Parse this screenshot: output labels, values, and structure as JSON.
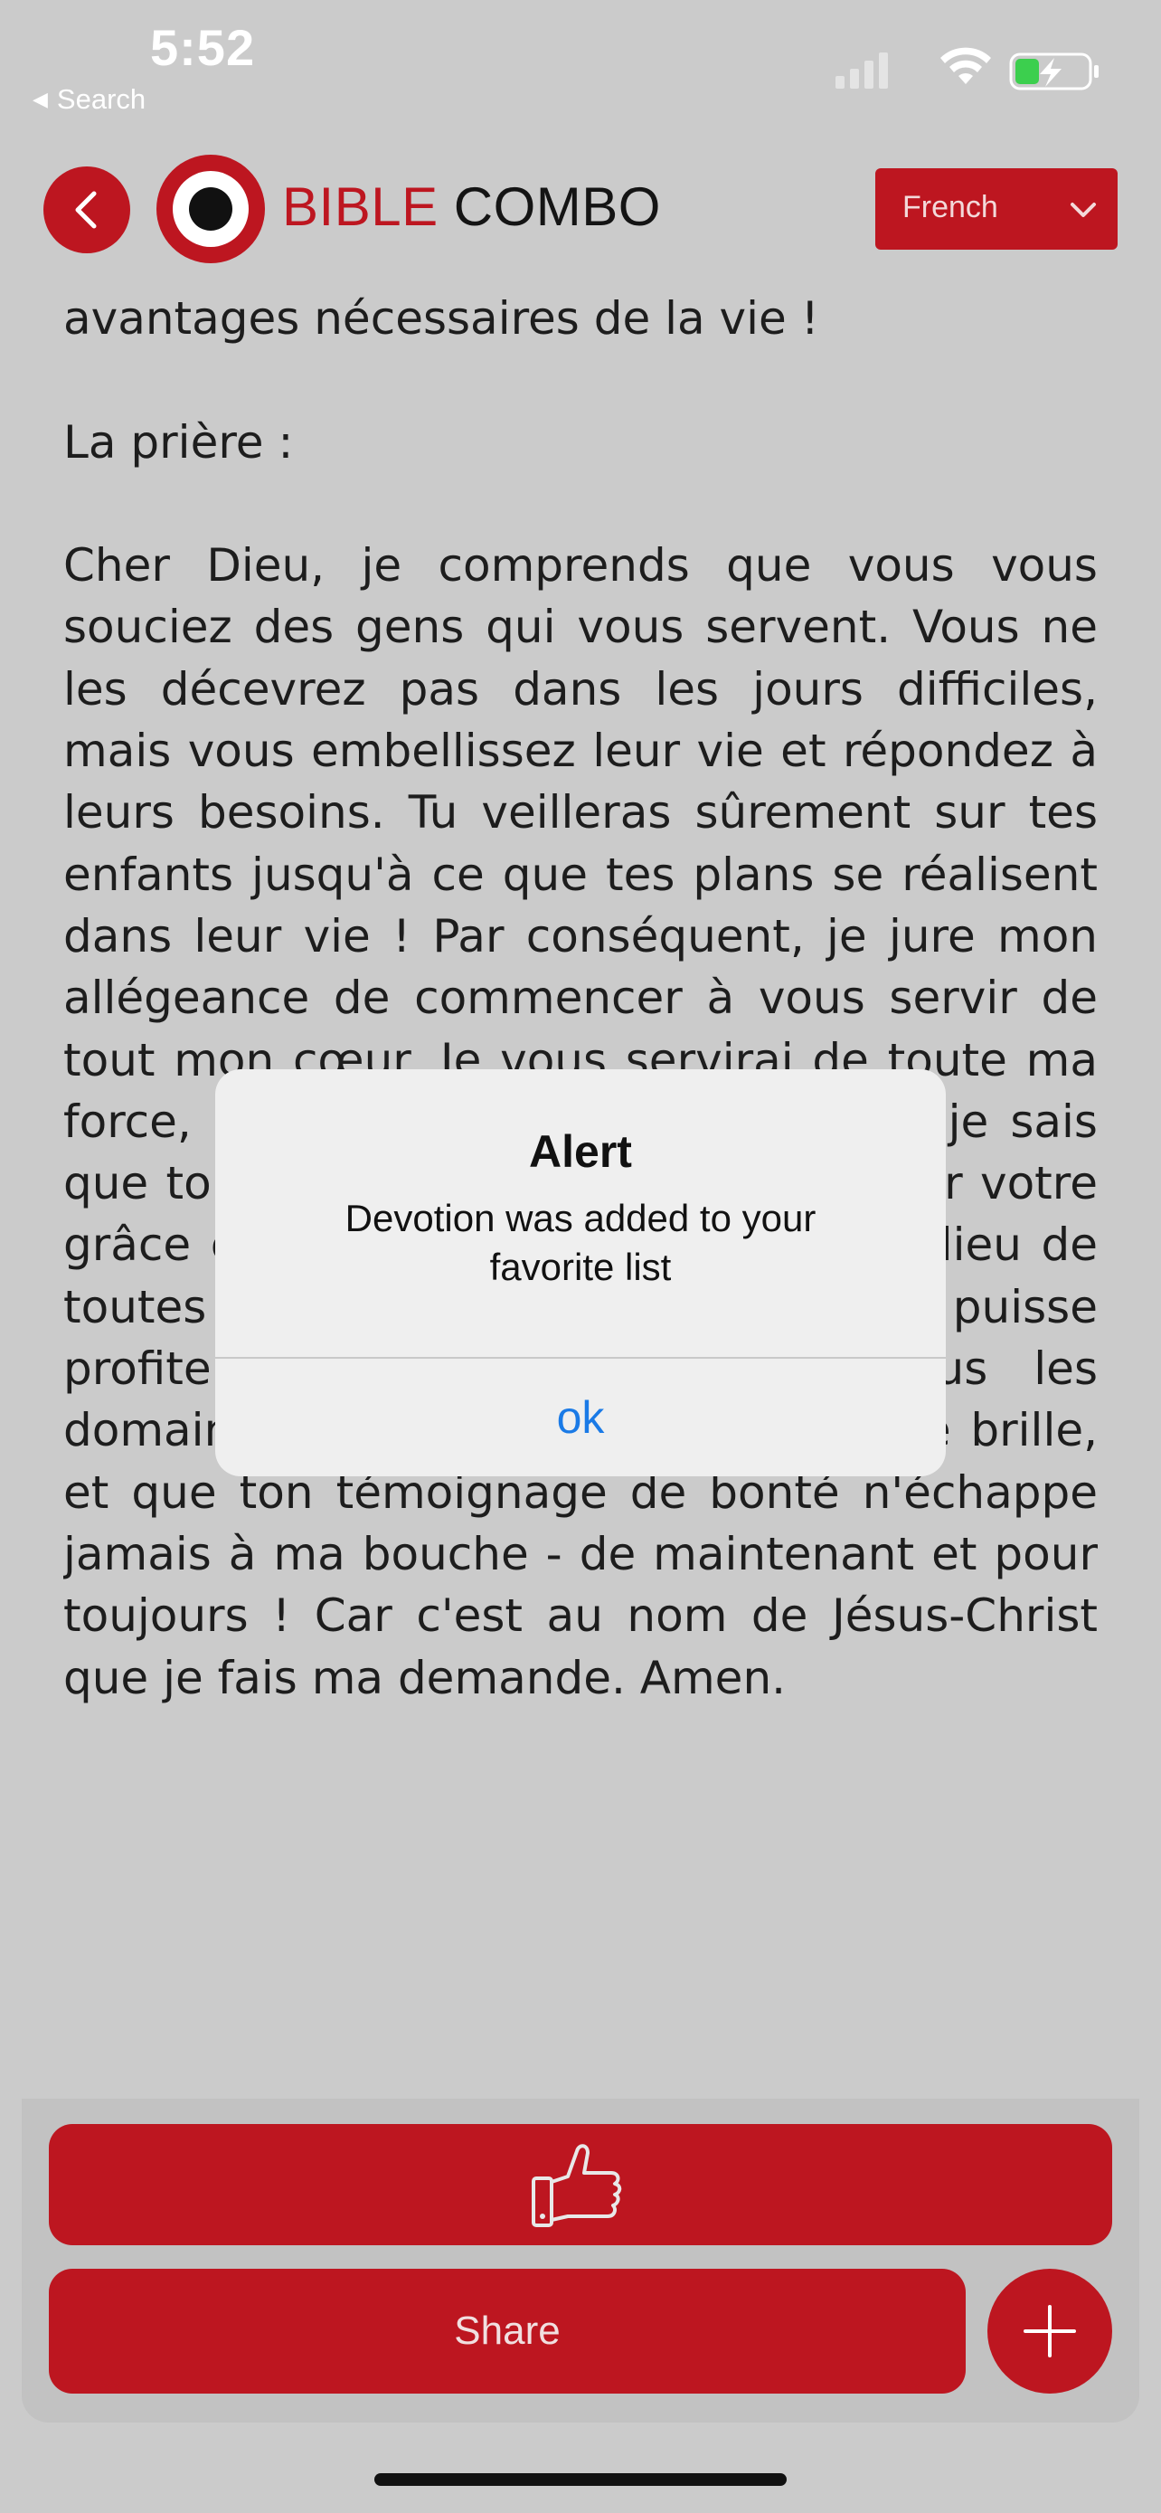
{
  "status_bar": {
    "time": "5:52",
    "back_label": "Search"
  },
  "header": {
    "brand_part1": "BIBLE",
    "brand_part2": "COMBO",
    "language": "French",
    "brand_color": "#bd1620"
  },
  "content": {
    "paragraphs": [
      "avantages nécessaires de la vie !",
      "La prière :",
      "Cher Dieu, je comprends que vous vous souciez des gens qui vous servent. Vous ne les décevrez pas dans les jours difficiles, mais vous embellissez leur vie et répondez à leurs besoins. Tu veilleras sûrement sur tes enfants jusqu'à ce que tes plans se réalisent dans leur vie ! Par conséquent, je jure mon allégeance de commencer à vous servir de tout mon cœur. Je vous servirai de toute ma force, et je continuerai à le faire car je sais que tout ce dont j'ai besoin sera là par votre grâce et votre faveur. Aide-moi au milieu de toutes les situations afin que je puisse profiter de tes bienfaits dans tous les domaines de ma vie. Que mon visage brille, et que ton témoignage de bonté n'échappe jamais à ma bouche - de maintenant et pour toujours ! Car c'est au nom de Jésus-Christ que je fais ma demande. Amen."
    ]
  },
  "alert": {
    "title": "Alert",
    "message": "Devotion was added to your favorite list",
    "ok_label": "ok"
  },
  "actions": {
    "like_icon": "thumbs-up-icon",
    "share_label": "Share",
    "add_icon": "plus-icon"
  }
}
